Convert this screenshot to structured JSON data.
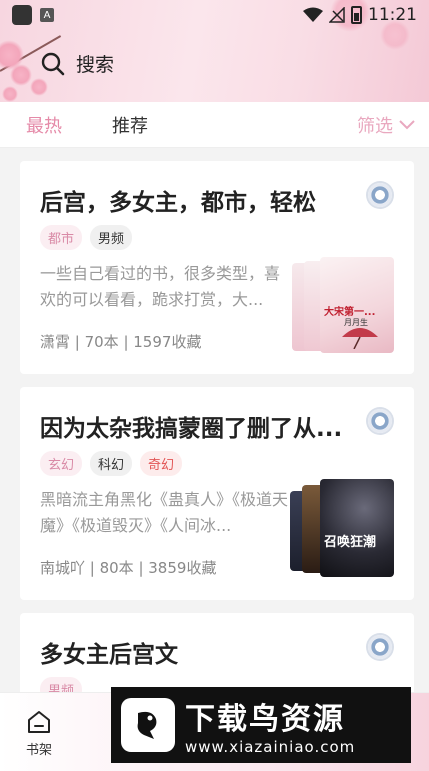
{
  "status_bar": {
    "time": "11:21"
  },
  "search": {
    "label": "搜索"
  },
  "tabs": [
    {
      "label": "最热",
      "active": true
    },
    {
      "label": "推荐",
      "active": false
    }
  ],
  "filter": {
    "label": "筛选"
  },
  "books": [
    {
      "title": "后宫，多女主，都市，轻松",
      "tags": [
        {
          "label": "都市",
          "style": "pink"
        },
        {
          "label": "男频",
          "style": "gray"
        }
      ],
      "description": "一些自己看过的书，很多类型，喜欢的可以看看，跪求打赏，大...",
      "meta": "潇霄 | 70本 | 1597收藏",
      "cover_text_1": "大宋第一...",
      "cover_text_2": "月月生"
    },
    {
      "title": "因为太杂我搞蒙圈了删了从...",
      "tags": [
        {
          "label": "玄幻",
          "style": "pink"
        },
        {
          "label": "科幻",
          "style": "gray"
        },
        {
          "label": "奇幻",
          "style": "red"
        }
      ],
      "description": "黑暗流主角黑化《蛊真人》《极道天魔》《极道毁灭》《人间冰...",
      "meta": "南城吖 | 80本 | 3859收藏",
      "cover_text_1": "召唤狂潮"
    },
    {
      "title": "多女主后宫文",
      "tags": [
        {
          "label": "男频",
          "style": "pink"
        }
      ]
    }
  ],
  "bottom_nav": {
    "label": "书架"
  },
  "watermark": {
    "title": "下载鸟资源",
    "url": "www.xiazainiao.com"
  },
  "colors": {
    "accent": "#e58aa8",
    "filter": "#e9a8bf",
    "header_pink": "#f7d6e0"
  }
}
